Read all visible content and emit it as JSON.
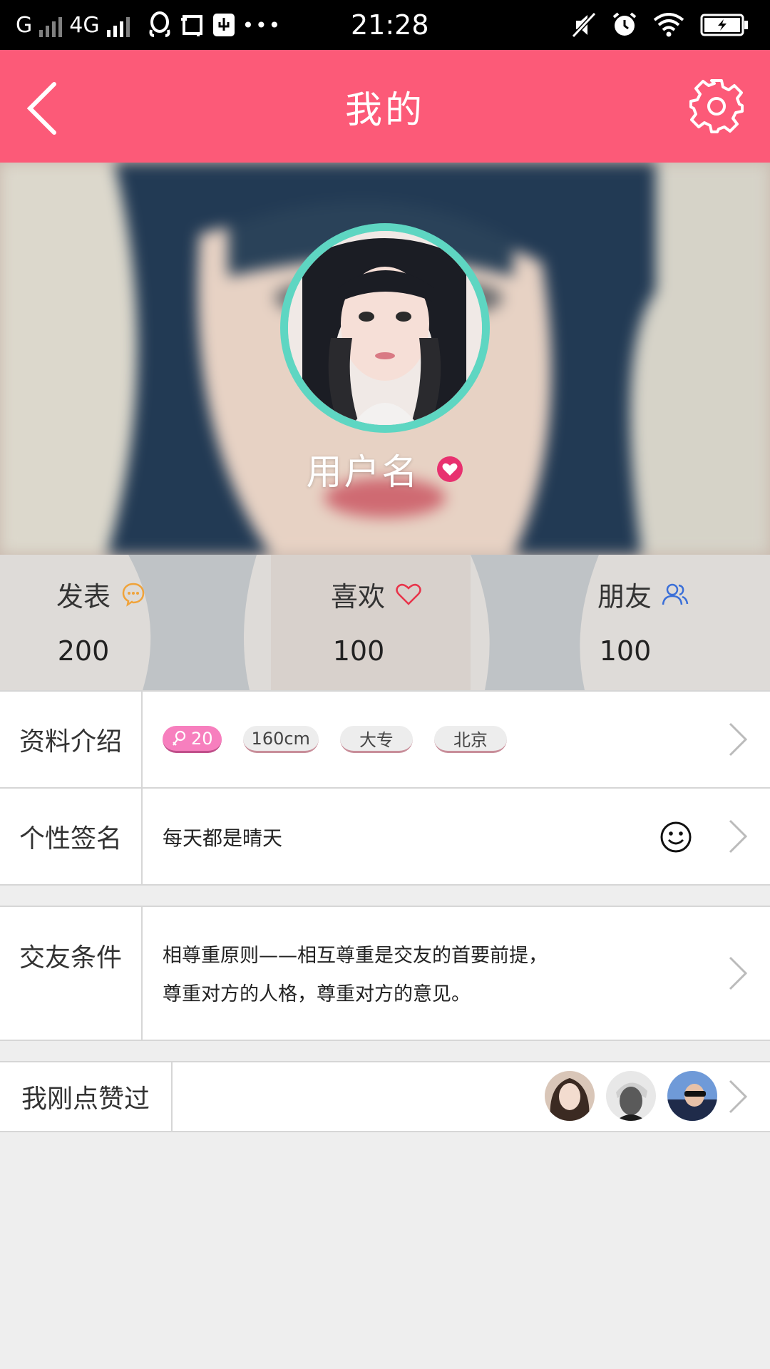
{
  "status_bar": {
    "carrier": "G",
    "network": "4G",
    "time": "21:28"
  },
  "header": {
    "title": "我的"
  },
  "profile": {
    "username": "用户名"
  },
  "stats": [
    {
      "label": "发表",
      "value": "200",
      "icon": "chat-bubble-icon",
      "icon_color": "#f0a33a"
    },
    {
      "label": "喜欢",
      "value": "100",
      "icon": "heart-outline-icon",
      "icon_color": "#e8344a"
    },
    {
      "label": "朋友",
      "value": "100",
      "icon": "friends-icon",
      "icon_color": "#3a6fd8"
    }
  ],
  "profile_info": {
    "label": "资料介绍",
    "tags": {
      "age": "20",
      "height": "160cm",
      "education": "大专",
      "city": "北京"
    }
  },
  "signature": {
    "label": "个性签名",
    "text": "每天都是晴天"
  },
  "friend_criteria": {
    "label": "交友条件",
    "line1": "相尊重原则——相互尊重是交友的首要前提，",
    "line2": "尊重对方的人格，尊重对方的意见。"
  },
  "recent_likes": {
    "label": "我刚点赞过"
  },
  "colors": {
    "header": "#fc5a78",
    "avatar_ring": "#5ed6c2",
    "age_tag": "#f77fbe"
  }
}
